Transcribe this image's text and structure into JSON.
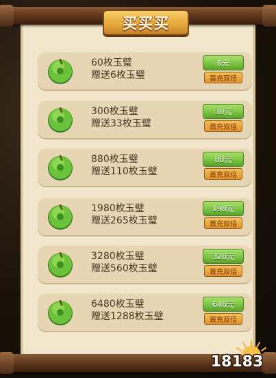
{
  "header": {
    "title": "买买买"
  },
  "offers": [
    {
      "amount": "60枚玉璧",
      "bonus": "赠送6枚玉璧",
      "price": "6元",
      "badge": "首充双倍"
    },
    {
      "amount": "300枚玉璧",
      "bonus": "赠送33枚玉璧",
      "price": "30元",
      "badge": "首充双倍"
    },
    {
      "amount": "880枚玉璧",
      "bonus": "赠送110枚玉璧",
      "price": "88元",
      "badge": "首充双倍"
    },
    {
      "amount": "1980枚玉璧",
      "bonus": "赠送265枚玉璧",
      "price": "198元",
      "badge": "首充双倍"
    },
    {
      "amount": "3280枚玉璧",
      "bonus": "赠送560枚玉璧",
      "price": "328元",
      "badge": "首充双倍"
    },
    {
      "amount": "6480枚玉璧",
      "bonus": "赠送1288枚玉璧",
      "price": "648元",
      "badge": "首充双倍"
    }
  ],
  "watermark": {
    "text": "18183"
  },
  "colors": {
    "parchment": "#f2e6cd",
    "card": "#e7d6b4",
    "price_button": "#7cc444",
    "badge": "#e0932c",
    "title_plate": "#e7a93a"
  },
  "icons": {
    "offer_icon": "jade-bi-icon"
  }
}
